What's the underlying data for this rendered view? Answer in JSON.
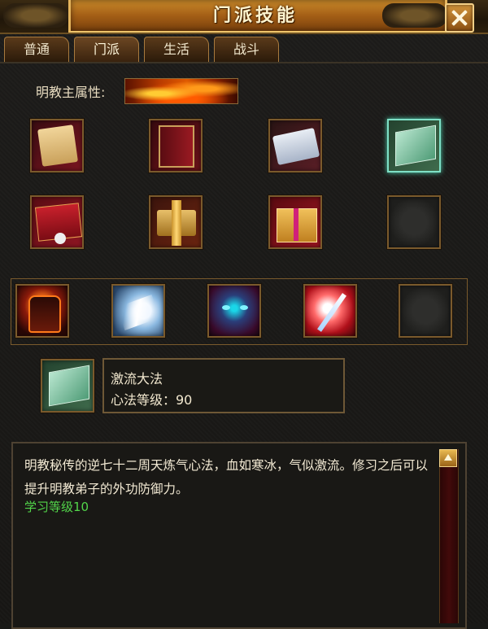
{
  "window": {
    "title": "门派技能",
    "close_label": ""
  },
  "tabs": [
    {
      "label": "普通",
      "active": false
    },
    {
      "label": "门派",
      "active": true
    },
    {
      "label": "生活",
      "active": false
    },
    {
      "label": "战斗",
      "active": false
    }
  ],
  "attribute": {
    "label": "明教主属性:"
  },
  "inner_skills": [
    {
      "icon": "scroll-icon",
      "selected": false
    },
    {
      "icon": "red-book-icon",
      "selected": false
    },
    {
      "icon": "blue-scroll-icon",
      "selected": false
    },
    {
      "icon": "green-book-icon",
      "selected": true
    },
    {
      "icon": "red-scroll-skull-icon",
      "selected": false
    },
    {
      "icon": "gold-scroll-icon",
      "selected": false
    },
    {
      "icon": "gift-box-icon",
      "selected": false
    },
    {
      "icon": "empty-slot",
      "selected": false
    }
  ],
  "martial_skills": [
    {
      "icon": "flame-armor-icon"
    },
    {
      "icon": "ice-wave-icon"
    },
    {
      "icon": "demon-skull-icon"
    },
    {
      "icon": "sword-slash-icon"
    },
    {
      "icon": "empty-slot"
    }
  ],
  "selected_skill": {
    "icon": "green-book-icon",
    "name": "激流大法",
    "level_text": "心法等级：90"
  },
  "description": {
    "text": "明教秘传的逆七十二周天炼气心法，血如寒冰，气似激流。修习之后可以提升明教弟子的外功防御力。",
    "learn_level": "学习等级10",
    "learn_color": "#52d64a"
  }
}
